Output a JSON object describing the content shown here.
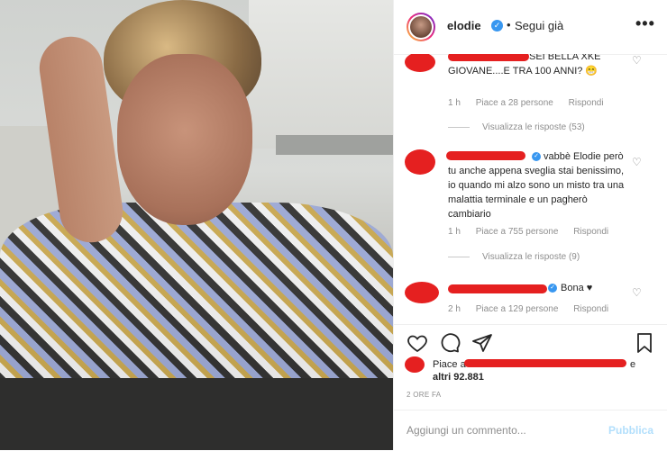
{
  "header": {
    "username": "elodie",
    "separator": "•",
    "follow_label": "Segui già",
    "more_label": "•••"
  },
  "comments": [
    {
      "text": "SEI BELLA XKE GIOVANE....E TRA 100 ANNI? 😁",
      "time": "1 h",
      "likes": "Piace a 28 persone",
      "reply": "Rispondi",
      "replies": "Visualizza le risposte (53)"
    },
    {
      "text": "vabbè Elodie però tu anche appena sveglia stai benissimo, io quando mi alzo sono un misto tra una malattia terminale e un pagherò cambiario",
      "time": "1 h",
      "likes": "Piace a 755 persone",
      "reply": "Rispondi",
      "replies": "Visualizza le risposte (9)"
    },
    {
      "text": "Bona ♥",
      "time": "2 h",
      "likes": "Piace a 129 persone",
      "reply": "Rispondi"
    }
  ],
  "likes": {
    "prefix": "Piace a",
    "suffix": "e",
    "others": "altri 92.881"
  },
  "timestamp": "2 ORE FA",
  "add_comment": {
    "placeholder": "Aggiungi un commento...",
    "publish": "Pubblica"
  }
}
